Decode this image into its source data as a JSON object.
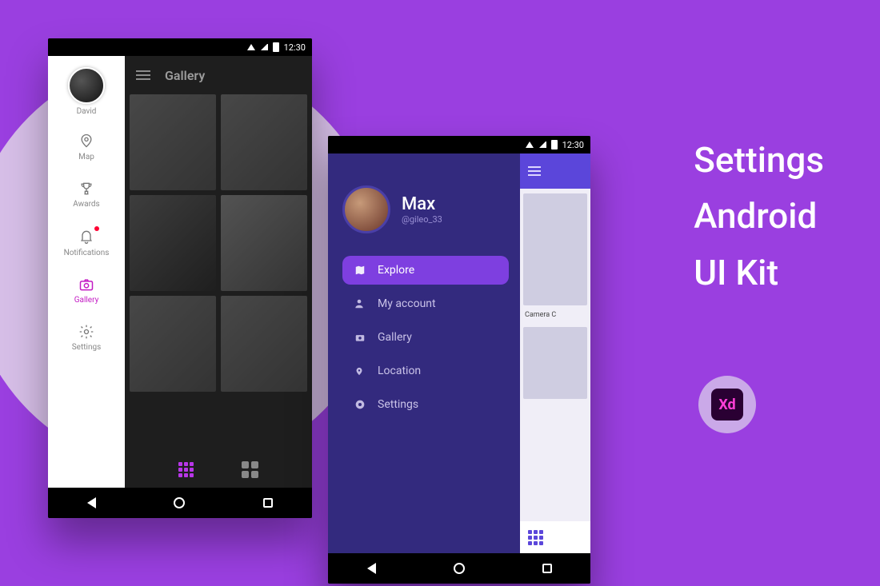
{
  "status": {
    "time": "12:30"
  },
  "phone1": {
    "user_name": "David",
    "gallery_title": "Gallery",
    "sidebar": [
      {
        "id": "map",
        "label": "Map",
        "active": false,
        "badge": false
      },
      {
        "id": "awards",
        "label": "Awards",
        "active": false,
        "badge": false
      },
      {
        "id": "notifications",
        "label": "Notifications",
        "active": false,
        "badge": true
      },
      {
        "id": "gallery",
        "label": "Gallery",
        "active": true,
        "badge": false
      },
      {
        "id": "settings",
        "label": "Settings",
        "active": false,
        "badge": false
      }
    ]
  },
  "phone2": {
    "profile": {
      "name": "Max",
      "handle": "@gileo_33"
    },
    "menu": [
      {
        "id": "explore",
        "label": "Explore",
        "active": true
      },
      {
        "id": "account",
        "label": "My account",
        "active": false
      },
      {
        "id": "gallery",
        "label": "Gallery",
        "active": false
      },
      {
        "id": "location",
        "label": "Location",
        "active": false
      },
      {
        "id": "settings",
        "label": "Settings",
        "active": false
      }
    ],
    "peek_caption": "Camera C"
  },
  "headline": {
    "line1": "Settings",
    "line2": "Android",
    "line3": "UI Kit"
  },
  "badge": {
    "label": "Xd"
  },
  "colors": {
    "brand": "#9a3fe0",
    "accent": "#7e3fe0",
    "drawer": "#332a7e",
    "active_pink": "#c31cc4"
  }
}
